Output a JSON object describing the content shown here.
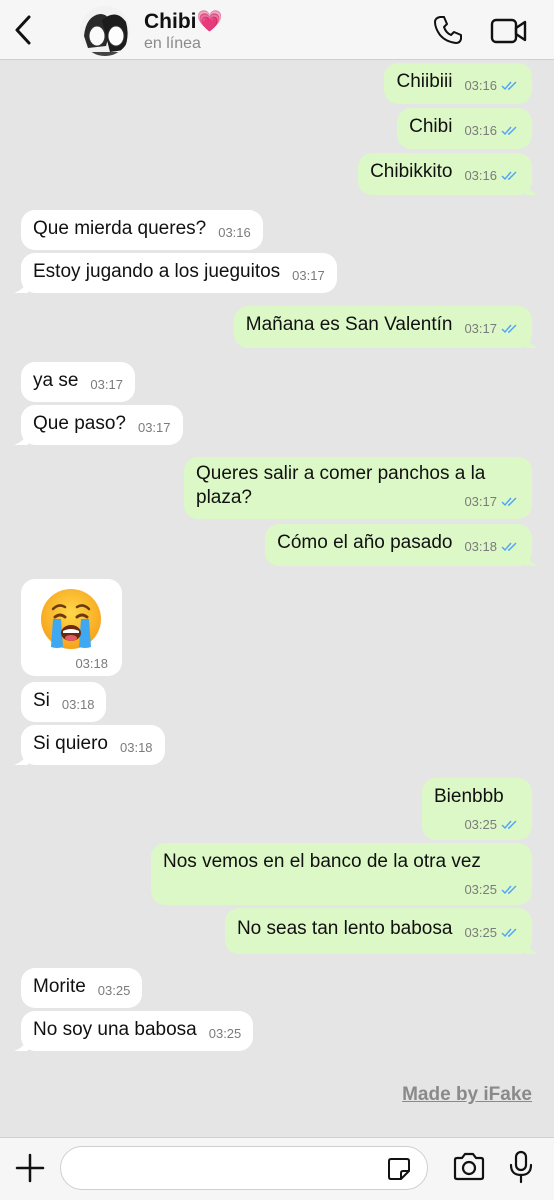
{
  "header": {
    "contact_name": "Chibi💗",
    "status": "en línea"
  },
  "messages": [
    {
      "dir": "out",
      "text": "Chiibiii",
      "time": "03:16",
      "read": true
    },
    {
      "dir": "out",
      "text": "Chibi",
      "time": "03:16",
      "read": true
    },
    {
      "dir": "out",
      "text": "Chibikkito",
      "time": "03:16",
      "read": true
    },
    {
      "dir": "in",
      "text": "Que mierda queres?",
      "time": "03:16"
    },
    {
      "dir": "in",
      "text": "Estoy jugando a los jueguitos",
      "time": "03:17"
    },
    {
      "dir": "out",
      "text": "Mañana es San Valentín",
      "time": "03:17",
      "read": true
    },
    {
      "dir": "in",
      "text": "ya se",
      "time": "03:17"
    },
    {
      "dir": "in",
      "text": "Que paso?",
      "time": "03:17"
    },
    {
      "dir": "out",
      "text": "Queres salir a comer panchos a la plaza?",
      "time": "03:17",
      "read": true
    },
    {
      "dir": "out",
      "text": "Cómo el año pasado",
      "time": "03:18",
      "read": true
    },
    {
      "dir": "in",
      "emoji": "😭",
      "time": "03:18"
    },
    {
      "dir": "in",
      "text": "Si",
      "time": "03:18"
    },
    {
      "dir": "in",
      "text": "Si quiero",
      "time": "03:18"
    },
    {
      "dir": "out",
      "text": "Bienbbb",
      "time": "03:25",
      "read": true
    },
    {
      "dir": "out",
      "text": "Nos vemos en el banco de la otra vez",
      "time": "03:25",
      "read": true
    },
    {
      "dir": "out",
      "text": "No seas tan lento babosa",
      "time": "03:25",
      "read": true
    },
    {
      "dir": "in",
      "text": "Morite",
      "time": "03:25"
    },
    {
      "dir": "in",
      "text": "No soy una babosa",
      "time": "03:25"
    }
  ],
  "watermark": "Made by iFake",
  "input": {
    "placeholder": ""
  },
  "colors": {
    "outgoing_bubble": "#dcf8c6",
    "incoming_bubble": "#ffffff",
    "chat_background": "#e5e5e5",
    "accent_blue": "#3497f9",
    "read_ticks": "#4fa3f7"
  },
  "icons": [
    "back-chevron-icon",
    "avatar",
    "phone-icon",
    "video-camera-icon",
    "plus-icon",
    "sticker-icon",
    "camera-icon",
    "microphone-icon",
    "double-check-icon"
  ]
}
